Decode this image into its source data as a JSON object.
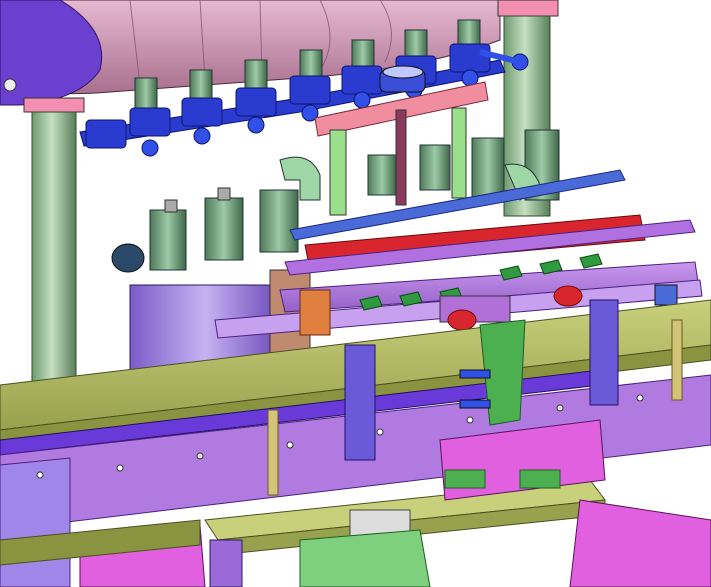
{
  "scene": {
    "subject": "filling-machine-cad-assembly",
    "background": "#ffffff",
    "colors": {
      "tank": "#c98fb0",
      "tank_end": "#6b3fd0",
      "pillar": "#9bbf9b",
      "manifold": "#2a3bd0",
      "valve_ball": "#3050e8",
      "cylinder": "#5d8f6f",
      "piston_body": "#9c7fe0",
      "plate_pink": "#f08ea0",
      "plate_red": "#d9262e",
      "rail": "#b06be0",
      "frame": "#b0b866",
      "frame_dark": "#8a9440",
      "base_purple": "#9b6ad8",
      "base_magenta": "#e060e0",
      "guard_green": "#7ed07e",
      "brass": "#d4c47a",
      "bolt": "#e0e0e0"
    }
  }
}
